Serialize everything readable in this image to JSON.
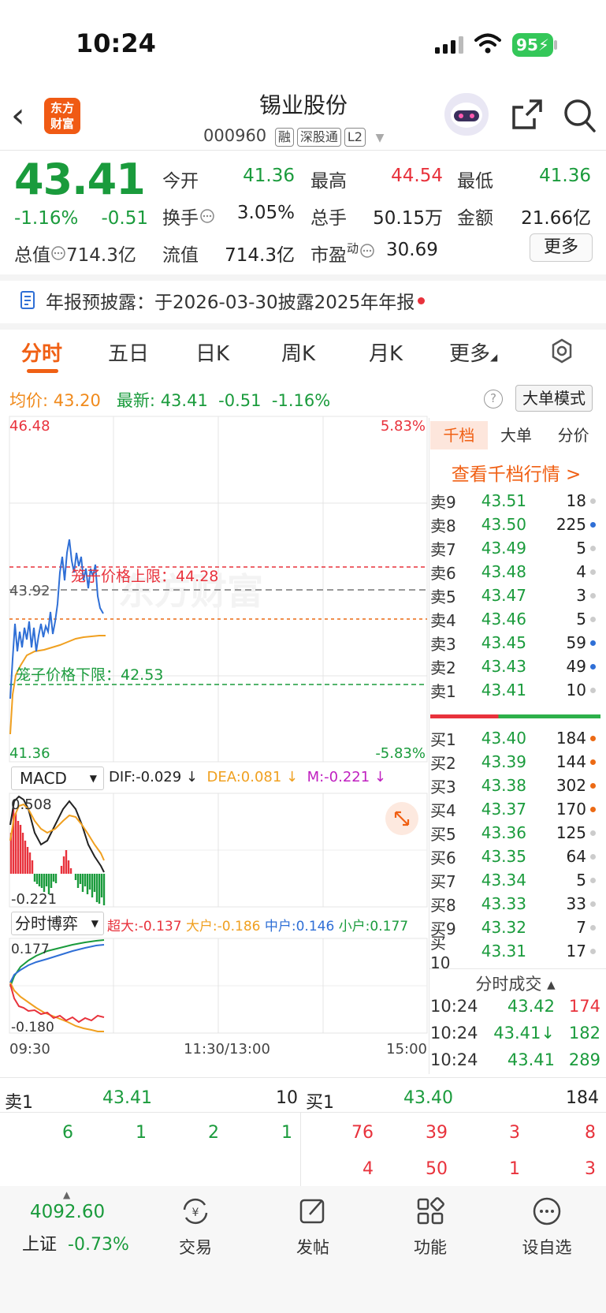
{
  "status": {
    "time": "10:24",
    "battery": "95"
  },
  "header": {
    "logo_line1": "东方",
    "logo_line2": "财富",
    "name": "锡业股份",
    "code": "000960",
    "tags": [
      "融",
      "深股通",
      "L2"
    ]
  },
  "quote": {
    "price": "43.41",
    "pct": "-1.16%",
    "chg": "-0.51",
    "open_label": "今开",
    "open": "41.36",
    "high_label": "最高",
    "high": "44.54",
    "low_label": "最低",
    "low": "41.36",
    "turnover_label": "换手",
    "turnover": "3.05%",
    "vol_label": "总手",
    "vol": "50.15万",
    "amount_label": "金额",
    "amount": "21.66亿",
    "mcap_label": "总值",
    "mcap": "714.3亿",
    "float_label": "流值",
    "float": "714.3亿",
    "pe_label": "市盈",
    "pe_sup": "动",
    "pe": "30.69",
    "more": "更多"
  },
  "notice": "年报预披露：于2026-03-30披露2025年年报",
  "tabs": [
    "分时",
    "五日",
    "日K",
    "周K",
    "月K",
    "更多"
  ],
  "info": {
    "avg_label": "均价:",
    "avg": "43.20",
    "last_label": "最新:",
    "last": "43.41",
    "chg": "-0.51",
    "pct": "-1.16%",
    "mode": "大单模式"
  },
  "chart_labels": {
    "top": "46.48",
    "top_pct": "5.83%",
    "mid": "43.92",
    "bottom": "41.36",
    "bottom_pct": "-5.83%",
    "upper_limit": "笼子价格上限：44.28",
    "lower_limit": "笼子价格下限：42.53",
    "watermark": "东方财富",
    "t0": "09:30",
    "t1": "11:30/13:00",
    "t2": "15:00"
  },
  "macd": {
    "select": "MACD",
    "dif": "DIF:-0.029 ↓",
    "dea": "DEA:0.081 ↓",
    "m": "M:-0.221 ↓",
    "top": "0.508",
    "bottom": "-0.221"
  },
  "game": {
    "select": "分时博弈",
    "super": "超大:-0.137",
    "large": "大户:-0.186",
    "mid": "中户:0.146",
    "small": "小户:0.177",
    "top": "0.177",
    "bottom": "-0.180"
  },
  "right_panel": {
    "tabs": [
      "千档",
      "大单",
      "分价"
    ],
    "link": "查看千档行情 >",
    "asks": [
      {
        "label": "卖9",
        "price": "43.51",
        "vol": "18",
        "dot": "#cccccc"
      },
      {
        "label": "卖8",
        "price": "43.50",
        "vol": "225",
        "dot": "#2f6fd6"
      },
      {
        "label": "卖7",
        "price": "43.49",
        "vol": "5",
        "dot": "#cccccc"
      },
      {
        "label": "卖6",
        "price": "43.48",
        "vol": "4",
        "dot": "#cccccc"
      },
      {
        "label": "卖5",
        "price": "43.47",
        "vol": "3",
        "dot": "#cccccc"
      },
      {
        "label": "卖4",
        "price": "43.46",
        "vol": "5",
        "dot": "#cccccc"
      },
      {
        "label": "卖3",
        "price": "43.45",
        "vol": "59",
        "dot": "#2f6fd6"
      },
      {
        "label": "卖2",
        "price": "43.43",
        "vol": "49",
        "dot": "#2f6fd6"
      },
      {
        "label": "卖1",
        "price": "43.41",
        "vol": "10",
        "dot": "#cccccc"
      }
    ],
    "bids": [
      {
        "label": "买1",
        "price": "43.40",
        "vol": "184",
        "dot": "#ec6a14"
      },
      {
        "label": "买2",
        "price": "43.39",
        "vol": "144",
        "dot": "#ec6a14"
      },
      {
        "label": "买3",
        "price": "43.38",
        "vol": "302",
        "dot": "#ec6a14"
      },
      {
        "label": "买4",
        "price": "43.37",
        "vol": "170",
        "dot": "#ec6a14"
      },
      {
        "label": "买5",
        "price": "43.36",
        "vol": "125",
        "dot": "#cccccc"
      },
      {
        "label": "买6",
        "price": "43.35",
        "vol": "64",
        "dot": "#cccccc"
      },
      {
        "label": "买7",
        "price": "43.34",
        "vol": "5",
        "dot": "#cccccc"
      },
      {
        "label": "买8",
        "price": "43.33",
        "vol": "33",
        "dot": "#cccccc"
      },
      {
        "label": "买9",
        "price": "43.32",
        "vol": "7",
        "dot": "#cccccc"
      },
      {
        "label": "买10",
        "price": "43.31",
        "vol": "17",
        "dot": "#cccccc"
      }
    ],
    "ticks_header": "分时成交 ▴",
    "ticks": [
      {
        "time": "10:24",
        "price": "43.42",
        "vol": "174",
        "color": "#e8323c"
      },
      {
        "time": "10:24",
        "price": "43.41↓",
        "vol": "182",
        "color": "#1a9b3c"
      },
      {
        "time": "10:24",
        "price": "43.41",
        "vol": "289",
        "color": "#1a9b3c"
      }
    ]
  },
  "board": {
    "ask_label": "卖1",
    "ask_price": "43.41",
    "ask_vol": "10",
    "bid_label": "买1",
    "bid_price": "43.40",
    "bid_vol": "184",
    "ask_queue": [
      "6",
      "1",
      "2",
      "1"
    ],
    "bid_queue1": [
      "76",
      "39",
      "3",
      "8"
    ],
    "bid_queue2": [
      "4",
      "50",
      "1",
      "3"
    ]
  },
  "index": {
    "value": "4092.60",
    "name": "上证",
    "pct": "-0.73%"
  },
  "nav": [
    "交易",
    "发帖",
    "功能",
    "设自选"
  ]
}
